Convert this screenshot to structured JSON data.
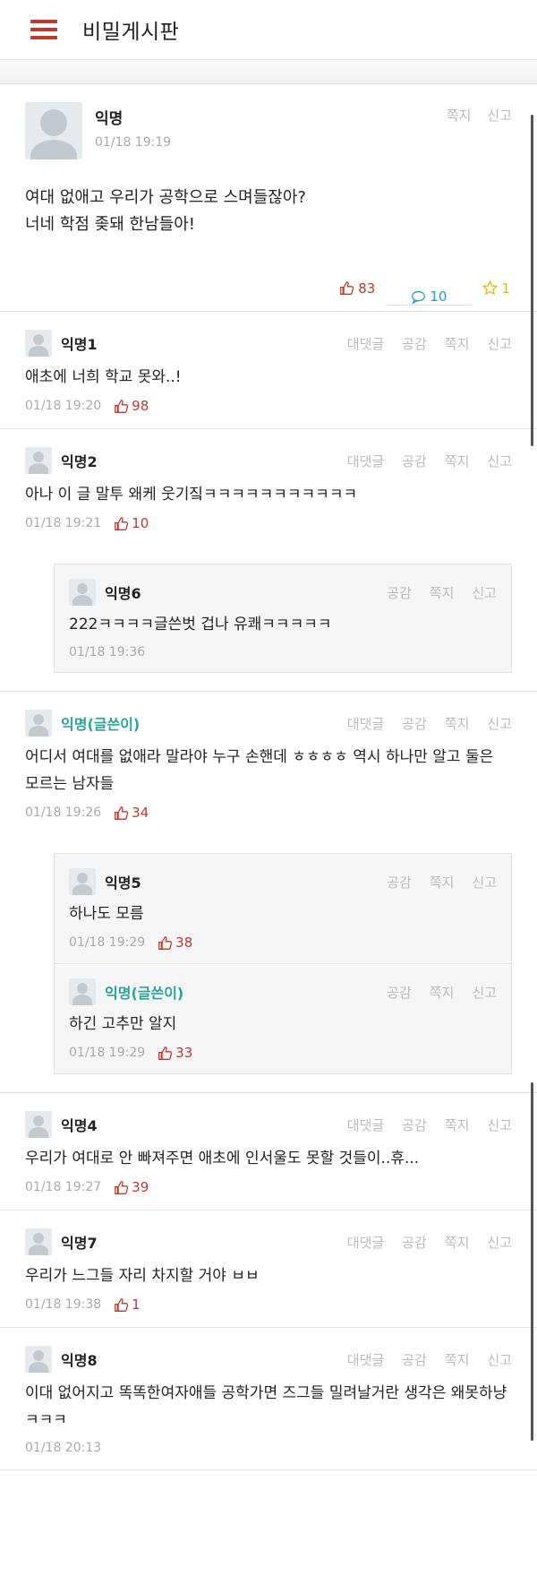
{
  "header": {
    "title": "비밀게시판"
  },
  "post": {
    "author": "익명",
    "time": "01/18 19:19",
    "actions": [
      "쪽지",
      "신고"
    ],
    "body_lines": [
      "여대 없애고 우리가 공학으로 스며들잖아?",
      "너네 학점 좆돼 한남들아!"
    ],
    "likes": "83",
    "comments": "10",
    "scraps": "1"
  },
  "comments": [
    {
      "author": "익명1",
      "op": false,
      "actions": [
        "대댓글",
        "공감",
        "쪽지",
        "신고"
      ],
      "body": "애초에 너희 학교 못와..!",
      "time": "01/18 19:20",
      "likes": "98",
      "replies": []
    },
    {
      "author": "익명2",
      "op": false,
      "actions": [
        "대댓글",
        "공감",
        "쪽지",
        "신고"
      ],
      "body": "아나 이 글 말투 왜케 웃기짘ㅋㅋㅋㅋㅋㅋㅋㅋㅋㅋㅋ",
      "time": "01/18 19:21",
      "likes": "10",
      "replies": [
        {
          "author": "익명6",
          "op": false,
          "actions": [
            "공감",
            "쪽지",
            "신고"
          ],
          "body": "222ㅋㅋㅋㅋ글쓴벗 겁나 유쾌ㅋㅋㅋㅋㅋ",
          "time": "01/18 19:36",
          "likes": ""
        }
      ]
    },
    {
      "author": "익명(글쓴이)",
      "op": true,
      "actions": [
        "대댓글",
        "공감",
        "쪽지",
        "신고"
      ],
      "body": "어디서 여대를 없애라 말라야 누구 손핸데 ㅎㅎㅎㅎ 역시 하나만 알고 둘은 모르는 남자들",
      "time": "01/18 19:26",
      "likes": "34",
      "replies": [
        {
          "author": "익명5",
          "op": false,
          "actions": [
            "공감",
            "쪽지",
            "신고"
          ],
          "body": "하나도 모름",
          "time": "01/18 19:29",
          "likes": "38"
        },
        {
          "author": "익명(글쓴이)",
          "op": true,
          "actions": [
            "공감",
            "쪽지",
            "신고"
          ],
          "body": "하긴 고추만 알지",
          "time": "01/18 19:29",
          "likes": "33"
        }
      ]
    },
    {
      "author": "익명4",
      "op": false,
      "actions": [
        "대댓글",
        "공감",
        "쪽지",
        "신고"
      ],
      "body": "우리가 여대로 안 빠져주면 애초에 인서울도 못할 것들이..휴...",
      "time": "01/18 19:27",
      "likes": "39",
      "replies": []
    },
    {
      "author": "익명7",
      "op": false,
      "actions": [
        "대댓글",
        "공감",
        "쪽지",
        "신고"
      ],
      "body": "우리가 느그들 자리 차지할 거야 ㅂㅂ",
      "time": "01/18 19:38",
      "likes": "1",
      "replies": []
    },
    {
      "author": "익명8",
      "op": false,
      "actions": [
        "대댓글",
        "공감",
        "쪽지",
        "신고"
      ],
      "body": "이대 없어지고 똑똑한여자애들 공학가면 즈그들 밀려날거란 생각은 왜못하냥ㅋㅋㅋ",
      "time": "01/18 20:13",
      "likes": "",
      "replies": []
    }
  ]
}
